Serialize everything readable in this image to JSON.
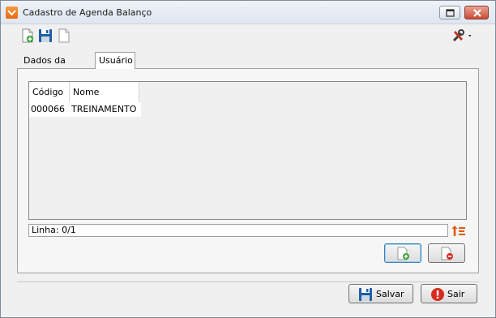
{
  "window": {
    "title": "Cadastro de Agenda Balanço"
  },
  "tabs": [
    {
      "label": "Dados da Agenda"
    },
    {
      "label": "Usuário"
    }
  ],
  "grid": {
    "columns": [
      "Código",
      "Nome"
    ],
    "rows": [
      {
        "codigo": "000066",
        "nome": "TREINAMENTO"
      }
    ]
  },
  "status": {
    "line_text": "Linha: 0/1"
  },
  "buttons": {
    "save": "Salvar",
    "exit": "Sair"
  },
  "colors": {
    "app_icon": "#e86812",
    "save_icon": "#1f5fa8",
    "exit_icon": "#d62b1f",
    "add_badge": "#3aa63a",
    "remove_badge": "#d62b1f"
  }
}
